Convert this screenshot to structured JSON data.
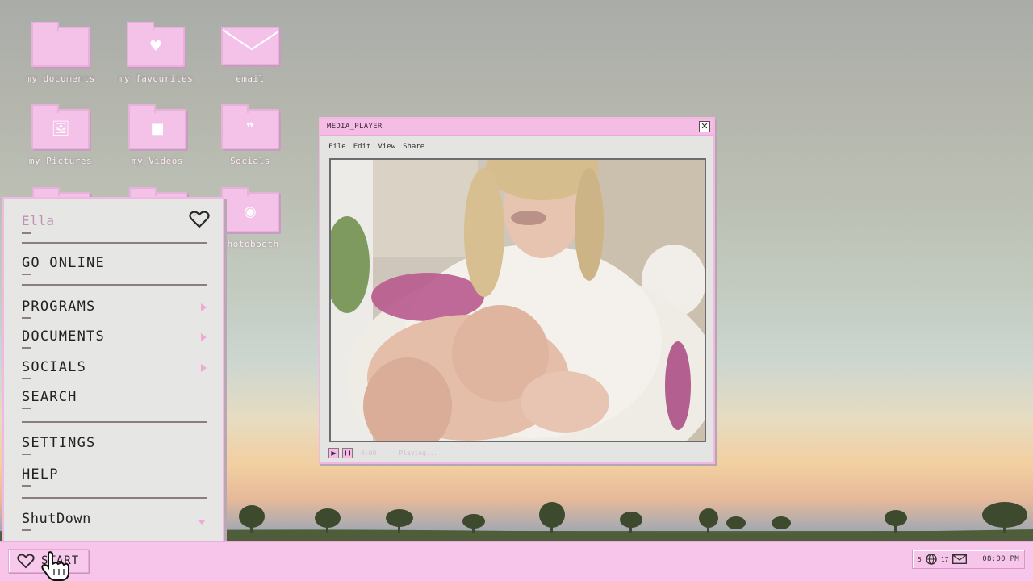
{
  "desktop": {
    "icons": [
      {
        "label": "my documents",
        "icon": "folder-icon"
      },
      {
        "label": "my favourites",
        "icon": "heart-folder-icon"
      },
      {
        "label": "email",
        "icon": "envelope-icon"
      },
      {
        "label": "my Pictures",
        "icon": "image-folder-icon"
      },
      {
        "label": "my Videos",
        "icon": "video-folder-icon"
      },
      {
        "label": "Socials",
        "icon": "quote-folder-icon"
      },
      {
        "label": "Photobooth",
        "icon": "camera-folder-icon"
      }
    ]
  },
  "media_player": {
    "title": "MEDIA_PLAYER",
    "close_symbol": "✕",
    "menu": [
      "File",
      "Edit",
      "View",
      "Share"
    ],
    "controls": {
      "play_symbol": "▶",
      "pause_symbol": "❚❚",
      "time": "0:00",
      "status": "Playing..."
    }
  },
  "start_menu": {
    "user_name": "Ella",
    "items": {
      "go_online": "GO ONLINE",
      "programs": "PROGRAMS",
      "documents": "DOCUMENTS",
      "socials": "SOCIALS",
      "search": "SEARCH",
      "settings": "SETTINGS",
      "help": "HELP",
      "shutdown": "ShutDown"
    }
  },
  "taskbar": {
    "start_label": "START",
    "tray": {
      "count_a": "5",
      "count_b": "17",
      "clock": "08:00 PM"
    }
  },
  "colors": {
    "accent_pink": "#f5bde6",
    "menu_bg": "#e6e6e4"
  }
}
